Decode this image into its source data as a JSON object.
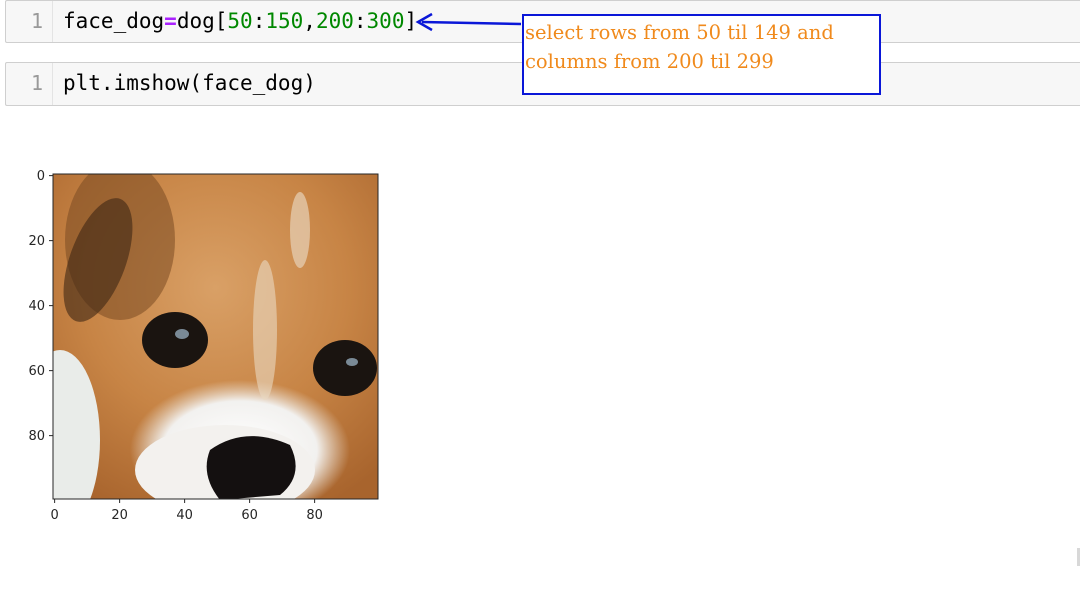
{
  "cells": [
    {
      "line_number": "1",
      "code_parts": {
        "var": "face_dog",
        "op": "=",
        "obj": "dog[",
        "n1": "50",
        "colon1": ":",
        "n2": "150",
        "comma": ",",
        "n3": "200",
        "colon2": ":",
        "n4": "300",
        "close": "]"
      }
    },
    {
      "line_number": "1",
      "code": "plt.imshow(face_dog)"
    }
  ],
  "annotation": {
    "line1": "select rows from 50 til 149 and",
    "line2": "columns from 200 til 299",
    "border_color": "#0a17d8",
    "text_color": "#f08a1c"
  },
  "plot": {
    "image_description": "dog-face",
    "x_ticks": [
      "0",
      "20",
      "40",
      "60",
      "80"
    ],
    "y_ticks": [
      "0",
      "20",
      "40",
      "60",
      "80"
    ]
  },
  "colors": {
    "code_number": "#008800",
    "code_operator": "#aa22ff",
    "cell_background": "#f7f7f7"
  }
}
